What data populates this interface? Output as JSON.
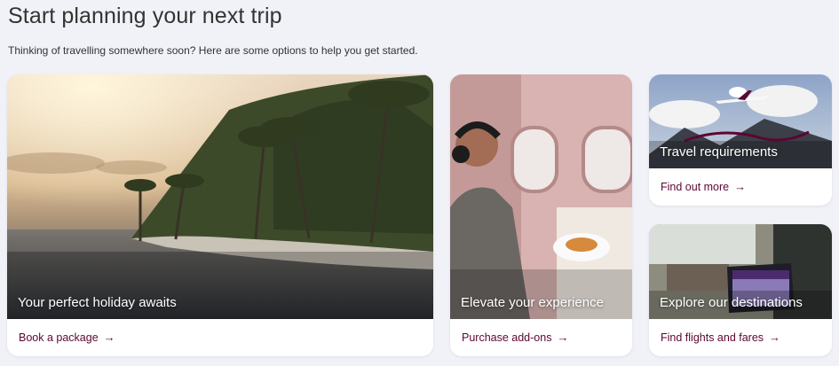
{
  "header": {
    "title": "Start planning your next trip",
    "subtitle": "Thinking of travelling somewhere soon? Here are some options to help you get started."
  },
  "cards": [
    {
      "image_label": "Your perfect holiday awaits",
      "link_label": "Book a package",
      "arrow": "→"
    },
    {
      "image_label": "Elevate your experience",
      "link_label": "Purchase add-ons",
      "arrow": "→"
    },
    {
      "image_label": "Travel requirements",
      "link_label": "Find out more",
      "arrow": "→"
    },
    {
      "image_label": "Explore our destinations",
      "link_label": "Find flights and fares",
      "arrow": "→"
    }
  ],
  "colors": {
    "link": "#5c0632",
    "background": "#f1f1f8"
  }
}
